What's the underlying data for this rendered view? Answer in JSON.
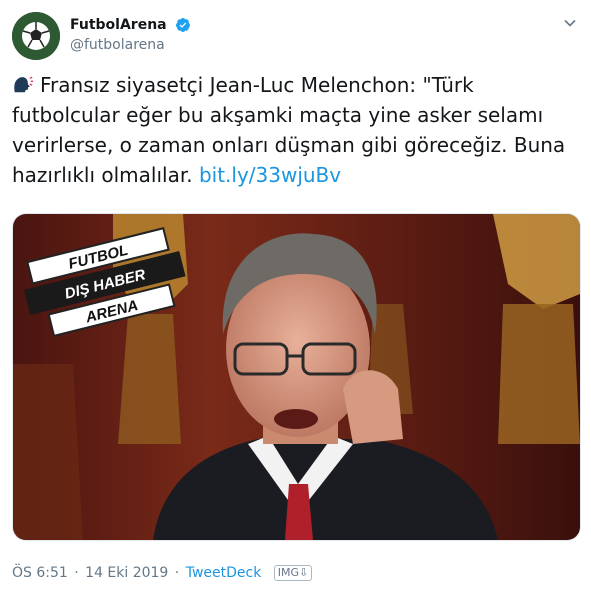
{
  "account": {
    "display_name": "FutbolArena",
    "handle": "@futbolarena",
    "verified": true
  },
  "tweet": {
    "text_main": "Fransız siyasetçi Jean-Luc Melenchon: \"Türk futbolcular eğer bu akşamki maçta yine asker selamı verirlerse, o zaman onları düşman gibi göreceğiz. Buna hazırlıklı olmalılar.",
    "link_text": "bit.ly/33wjuBv",
    "emoji": "speaking-head-icon"
  },
  "media": {
    "badge_line1": "FUTBOL",
    "badge_line2": "DIŞ HABER",
    "badge_line3": "ARENA"
  },
  "meta": {
    "time": "ÖS 6:51",
    "separator": "·",
    "date": "14 Eki 2019",
    "source": "TweetDeck",
    "img_label": "IMG"
  },
  "colors": {
    "link": "#1b95e0",
    "secondary_text": "#657786",
    "verified_blue": "#1da1f2"
  }
}
